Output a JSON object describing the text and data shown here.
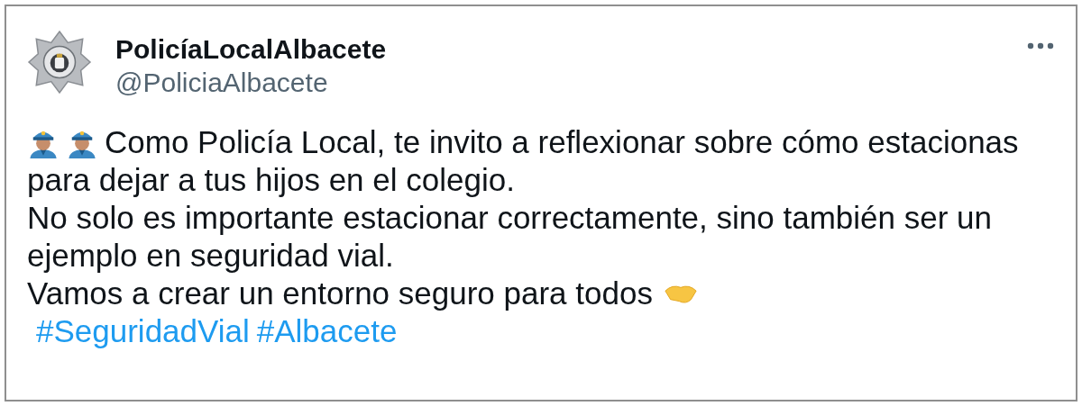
{
  "author": {
    "name": "PolicíaLocalAlbacete",
    "handle": "@PoliciaAlbacete"
  },
  "lines": [
    {
      "text": "Como Policía Local, te invito a reflexionar sobre cómo estacionas"
    },
    {
      "text": "para dejar a tus hijos en el colegio."
    },
    {
      "text": "No solo es importante estacionar correctamente, sino también ser un"
    },
    {
      "text": "ejemplo en seguridad vial."
    },
    {
      "text": "Vamos a crear un entorno seguro para todos"
    }
  ],
  "hashtags": [
    "#SeguridadVial",
    "#Albacete"
  ]
}
